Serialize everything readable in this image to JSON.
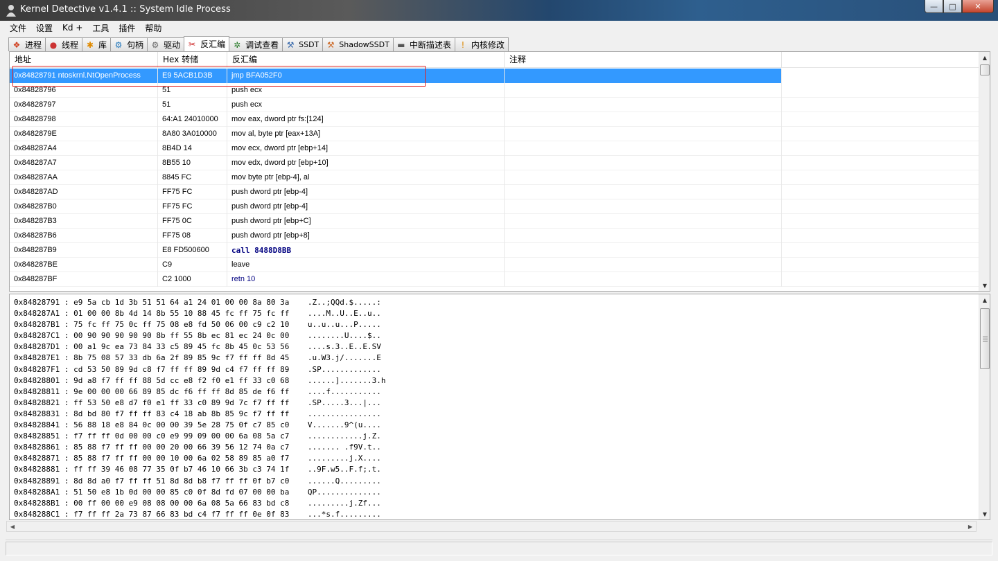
{
  "window": {
    "title": "Kernel Detective v1.4.1 :: System Idle Process",
    "controls": {
      "minimize": "—",
      "maximize": "□",
      "close": "✕"
    }
  },
  "menu": [
    "文件",
    "设置",
    "Kd +",
    "工具",
    "插件",
    "帮助"
  ],
  "tabs": [
    {
      "label": "进程",
      "icon": "windows-flag-icon",
      "glyph": "❖",
      "color": "#d04020"
    },
    {
      "label": "线程",
      "icon": "thread-icon",
      "glyph": "●",
      "color": "#cc3333"
    },
    {
      "label": "库",
      "icon": "library-icon",
      "glyph": "✱",
      "color": "#e08a00"
    },
    {
      "label": "句柄",
      "icon": "handle-icon",
      "glyph": "⚙",
      "color": "#2277bb"
    },
    {
      "label": "驱动",
      "icon": "gear-icon",
      "glyph": "⚙",
      "color": "#666666"
    },
    {
      "label": "反汇编",
      "icon": "disassemble-icon",
      "glyph": "✂",
      "color": "#cc2222",
      "active": true
    },
    {
      "label": "调试查看",
      "icon": "debug-icon",
      "glyph": "✲",
      "color": "#227722"
    },
    {
      "label": "SSDT",
      "icon": "wrench-icon",
      "glyph": "⚒",
      "color": "#3366aa"
    },
    {
      "label": "ShadowSSDT",
      "icon": "wrench-icon",
      "glyph": "⚒",
      "color": "#cc6622"
    },
    {
      "label": "中断描述表",
      "icon": "chip-icon",
      "glyph": "▬",
      "color": "#555555"
    },
    {
      "label": "内核修改",
      "icon": "warning-icon",
      "glyph": "!",
      "color": "#dd8800"
    }
  ],
  "disasm": {
    "columns": [
      "地址",
      "Hex 转储",
      "反汇编",
      "注释"
    ],
    "rows": [
      {
        "addr": "0x84828791 ntoskrnl.NtOpenProcess",
        "hex": "E9 5ACB1D3B",
        "asm": "jmp BFA052F0",
        "note": "",
        "selected": true
      },
      {
        "addr": "0x84828796",
        "hex": "51",
        "asm": "push ecx",
        "note": ""
      },
      {
        "addr": "0x84828797",
        "hex": "51",
        "asm": "push ecx",
        "note": ""
      },
      {
        "addr": "0x84828798",
        "hex": "64:A1 24010000",
        "asm": "mov eax, dword ptr fs:[124]",
        "note": ""
      },
      {
        "addr": "0x8482879E",
        "hex": "8A80 3A010000",
        "asm": "mov al, byte ptr [eax+13A]",
        "note": ""
      },
      {
        "addr": "0x848287A4",
        "hex": "8B4D 14",
        "asm": "mov ecx, dword ptr [ebp+14]",
        "note": ""
      },
      {
        "addr": "0x848287A7",
        "hex": "8B55 10",
        "asm": "mov edx, dword ptr [ebp+10]",
        "note": ""
      },
      {
        "addr": "0x848287AA",
        "hex": "8845 FC",
        "asm": "mov byte ptr [ebp-4], al",
        "note": ""
      },
      {
        "addr": "0x848287AD",
        "hex": "FF75 FC",
        "asm": "push dword ptr [ebp-4]",
        "note": ""
      },
      {
        "addr": "0x848287B0",
        "hex": "FF75 FC",
        "asm": "push dword ptr [ebp-4]",
        "note": ""
      },
      {
        "addr": "0x848287B3",
        "hex": "FF75 0C",
        "asm": "push dword ptr [ebp+C]",
        "note": ""
      },
      {
        "addr": "0x848287B6",
        "hex": "FF75 08",
        "asm": "push dword ptr [ebp+8]",
        "note": ""
      },
      {
        "addr": "0x848287B9",
        "hex": "E8 FD500600",
        "asm": "call 8488D8BB",
        "note": "",
        "kind": "call"
      },
      {
        "addr": "0x848287BE",
        "hex": "C9",
        "asm": "leave",
        "note": ""
      },
      {
        "addr": "0x848287BF",
        "hex": "C2 1000",
        "asm": "retn 10",
        "note": "",
        "kind": "retn"
      }
    ]
  },
  "hexdump": [
    {
      "addr": "0x84828791",
      "bytes": "e9 5a cb 1d 3b 51 51 64 a1 24 01 00 00 8a 80 3a",
      "ascii": ".Z..;QQd.$.....:"
    },
    {
      "addr": "0x848287A1",
      "bytes": "01 00 00 8b 4d 14 8b 55 10 88 45 fc ff 75 fc ff",
      "ascii": "....M..U..E..u.."
    },
    {
      "addr": "0x848287B1",
      "bytes": "75 fc ff 75 0c ff 75 08 e8 fd 50 06 00 c9 c2 10",
      "ascii": "u..u..u...P....."
    },
    {
      "addr": "0x848287C1",
      "bytes": "00 90 90 90 90 90 8b ff 55 8b ec 81 ec 24 0c 00",
      "ascii": "........U....$.."
    },
    {
      "addr": "0x848287D1",
      "bytes": "00 a1 9c ea 73 84 33 c5 89 45 fc 8b 45 0c 53 56",
      "ascii": "....s.3..E..E.SV"
    },
    {
      "addr": "0x848287E1",
      "bytes": "8b 75 08 57 33 db 6a 2f 89 85 9c f7 ff ff 8d 45",
      "ascii": ".u.W3.j/.......E"
    },
    {
      "addr": "0x848287F1",
      "bytes": "cd 53 50 89 9d c8 f7 ff ff 89 9d c4 f7 ff ff 89",
      "ascii": ".SP............."
    },
    {
      "addr": "0x84828801",
      "bytes": "9d a8 f7 ff ff 88 5d cc e8 f2 f0 e1 ff 33 c0 68",
      "ascii": "......].......3.h"
    },
    {
      "addr": "0x84828811",
      "bytes": "9e 00 00 00 66 89 85 dc f6 ff ff 8d 85 de f6 ff",
      "ascii": "....f..........."
    },
    {
      "addr": "0x84828821",
      "bytes": "ff 53 50 e8 d7 f0 e1 ff 33 c0 89 9d 7c f7 ff ff",
      "ascii": ".SP.....3...|..."
    },
    {
      "addr": "0x84828831",
      "bytes": "8d bd 80 f7 ff ff 83 c4 18 ab 8b 85 9c f7 ff ff",
      "ascii": "................"
    },
    {
      "addr": "0x84828841",
      "bytes": "56 88 18 e8 84 0c 00 00 39 5e 28 75 0f c7 85 c0",
      "ascii": "V.......9^(u...."
    },
    {
      "addr": "0x84828851",
      "bytes": "f7 ff ff 0d 00 00 c0 e9 99 09 00 00 6a 08 5a c7",
      "ascii": "............j.Z."
    },
    {
      "addr": "0x84828861",
      "bytes": "85 88 f7 ff ff 00 00 20 00 66 39 56 12 74 0a c7",
      "ascii": "....... .f9V.t.."
    },
    {
      "addr": "0x84828871",
      "bytes": "85 88 f7 ff ff 00 00 10 00 6a 02 58 89 85 a0 f7",
      "ascii": ".........j.X...."
    },
    {
      "addr": "0x84828881",
      "bytes": "ff ff 39 46 08 77 35 0f b7 46 10 66 3b c3 74 1f",
      "ascii": "..9F.w5..F.f;.t."
    },
    {
      "addr": "0x84828891",
      "bytes": "8d 8d a0 f7 ff ff 51 8d 8d b8 f7 ff ff 0f b7 c0",
      "ascii": "......Q........."
    },
    {
      "addr": "0x848288A1",
      "bytes": "51 50 e8 1b 0d 00 00 85 c0 0f 8d fd 07 00 00 ba",
      "ascii": "QP.............."
    },
    {
      "addr": "0x848288B1",
      "bytes": "00 ff 00 00 e9 08 08 00 00 6a 08 5a 66 83 bd c8",
      "ascii": ".........j.Zf..."
    },
    {
      "addr": "0x848288C1",
      "bytes": "f7 ff ff 2a 73 87 66 83 bd c4 f7 ff ff 0e 0f 83",
      "ascii": "...*s.f........."
    }
  ]
}
